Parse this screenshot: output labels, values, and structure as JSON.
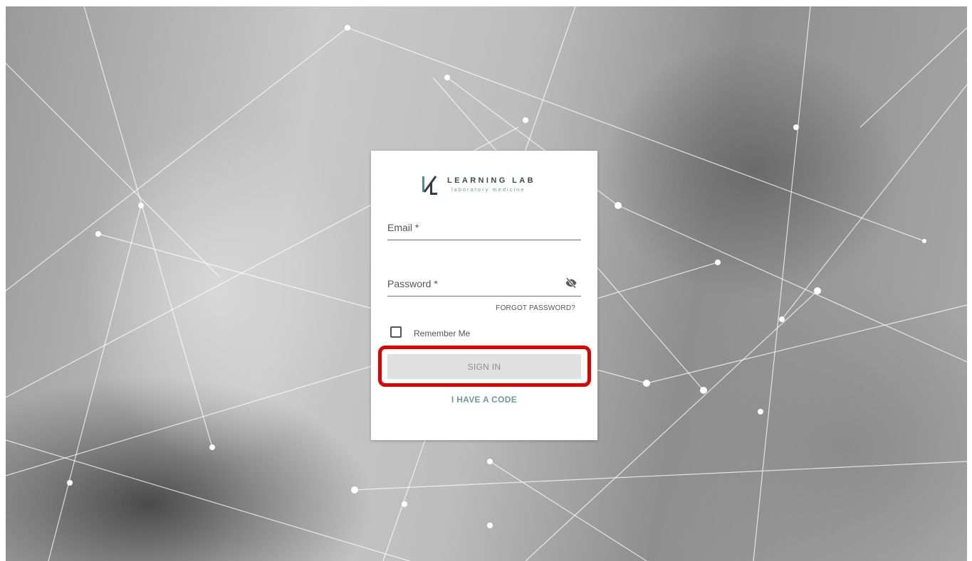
{
  "logo": {
    "title": "LEARNING LAB",
    "subtitle": "laboratory medicine",
    "icon": "learning-lab-logo"
  },
  "form": {
    "email_label": "Email *",
    "email_value": "",
    "password_label": "Password *",
    "password_value": "",
    "password_toggle_icon": "eye-off-icon",
    "forgot_password": "FORGOT PASSWORD?",
    "remember_me": "Remember Me",
    "remember_checked": false,
    "sign_in": "SIGN IN",
    "have_code": "I HAVE A CODE"
  },
  "colors": {
    "accent": "#6f9a98",
    "highlight": "#e10000",
    "button_bg": "#e0e0e0"
  }
}
